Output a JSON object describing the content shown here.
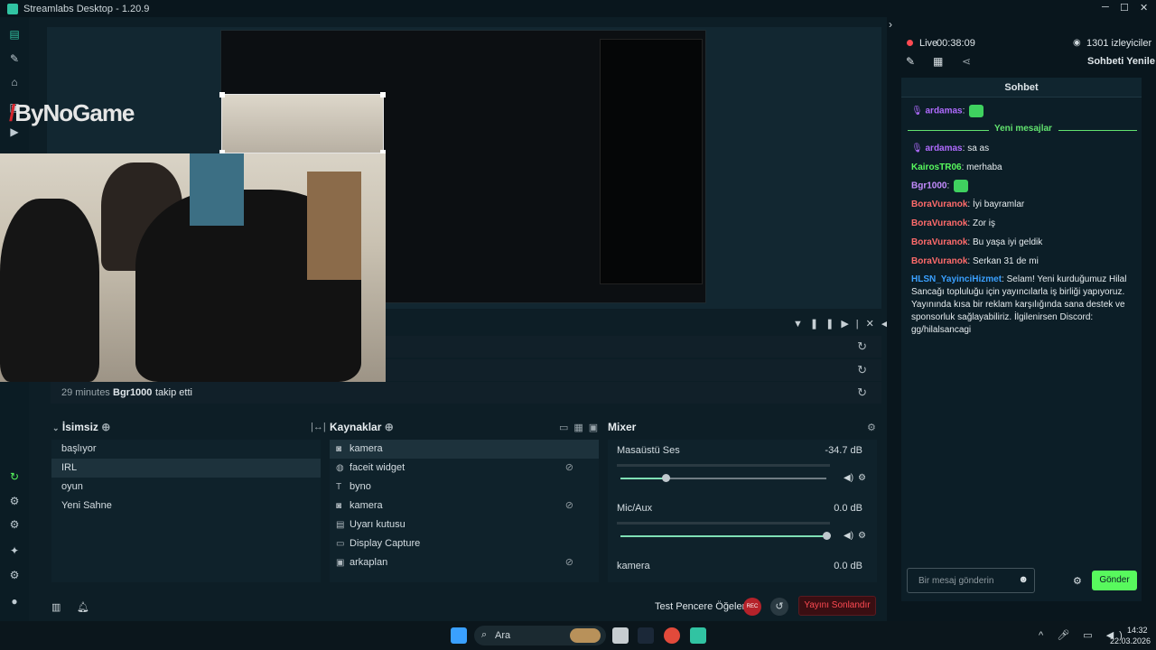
{
  "app": {
    "title": "Streamlabs Desktop - 1.20.9",
    "minimize": "─",
    "maximize": "☐",
    "close": "✕"
  },
  "nav": {
    "icons": [
      "editor-icon",
      "themes-icon",
      "store-icon",
      "highlighter-icon",
      "live-icon",
      "studio-mode-icon",
      "layout-icon",
      "record-icon",
      "apps-icon",
      "settings-icon",
      "profile-icon"
    ]
  },
  "preview": {
    "overlay_text": "ByNoGame",
    "overlay_slash": "/"
  },
  "activity": {
    "follow_time": "29 minutes",
    "follow_user": "Bgr1000",
    "follow_action": "takip etti"
  },
  "scenes": {
    "title": "İsimsiz",
    "items": [
      "başlıyor",
      "IRL",
      "oyun",
      "Yeni Sahne"
    ],
    "selected": "IRL"
  },
  "sources": {
    "title": "Kaynaklar",
    "items": [
      {
        "label": "kamera",
        "icon": "camera-icon",
        "hidden": false
      },
      {
        "label": "faceit widget",
        "icon": "globe-icon",
        "hidden": true
      },
      {
        "label": "byno",
        "icon": "text-icon",
        "hidden": false
      },
      {
        "label": "kamera",
        "icon": "camera-icon",
        "hidden": true
      },
      {
        "label": "Uyarı kutusu",
        "icon": "alert-box-icon",
        "hidden": false
      },
      {
        "label": "Display Capture",
        "icon": "monitor-icon",
        "hidden": false
      },
      {
        "label": "arkaplan",
        "icon": "image-icon",
        "hidden": true
      }
    ]
  },
  "mixer": {
    "title": "Mixer",
    "channels": [
      {
        "label": "Masaüstü Ses",
        "db": "-34.7 dB",
        "level": 0.22
      },
      {
        "label": "Mic/Aux",
        "db": "0.0 dB",
        "level": 1.0
      },
      {
        "label": "kamera",
        "db": "0.0 dB",
        "level": 1.0
      }
    ]
  },
  "footer": {
    "test_label": "Test Pencere Öğeleri",
    "rec_label": "REC",
    "end_label": "Yayını Sonlandır"
  },
  "stream": {
    "live_label": "Live",
    "time": "00:38:09",
    "viewers": "1301 izleyiciler",
    "refresh_chat": "Sohbeti Yenile"
  },
  "chat": {
    "header": "Sohbet",
    "new_messages": "Yeni mesajlar",
    "input_placeholder": "Bir mesaj gönderin",
    "send": "Gönder",
    "messages": [
      {
        "user": "ardamas",
        "text": "",
        "color": "#b06bff",
        "emote": true
      },
      {
        "user": "ardamas",
        "text": "sa as",
        "color": "#b06bff",
        "emote": false
      },
      {
        "user": "KairosTR06",
        "text": "merhaba",
        "color": "#58f95d",
        "emote": false
      },
      {
        "user": "Bgr1000",
        "text": "",
        "color": "#c48cff",
        "emote": true
      },
      {
        "user": "BoraVuranok",
        "text": "İyi bayramlar",
        "color": "#ff6b6b",
        "emote": false
      },
      {
        "user": "BoraVuranok",
        "text": "Zor iş",
        "color": "#ff6b6b",
        "emote": false
      },
      {
        "user": "BoraVuranok",
        "text": "Bu yaşa iyi geldik",
        "color": "#ff6b6b",
        "emote": false
      },
      {
        "user": "BoraVuranok",
        "text": "Serkan 31 de mi",
        "color": "#ff6b6b",
        "emote": false
      },
      {
        "user": "HLSN_YayinciHizmet",
        "text": "Selam! Yeni kurduğumuz Hilal Sancağı topluluğu için yayıncılarla iş birliği yapıyoruz. Yayınında kısa bir reklam karşılığında sana destek ve sponsorluk sağlayabiliriz. İlgilenirsen Discord: gg/hilalsancagi",
        "color": "#3aa0ff",
        "emote": false
      }
    ]
  },
  "taskbar": {
    "search": "Ara",
    "time": "14:32",
    "date": "22.03.2026"
  }
}
